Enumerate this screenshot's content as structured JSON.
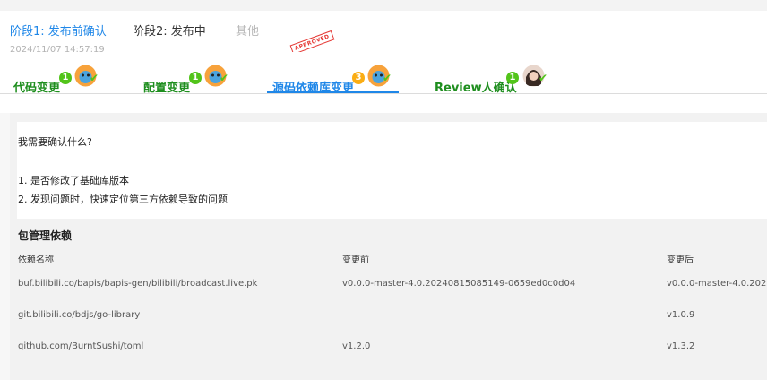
{
  "stages": [
    {
      "label": "阶段1: 发布前确认",
      "time": "2024/11/07 14:57:19"
    },
    {
      "label": "阶段2: 发布中"
    },
    {
      "label": "其他"
    }
  ],
  "stamp_text": "APPROVED",
  "tabs": [
    {
      "label": "代码变更",
      "count": "1"
    },
    {
      "label": "配置变更",
      "count": "1"
    },
    {
      "label": "源码依赖库变更",
      "count": "3"
    },
    {
      "label": "Review人确认",
      "count": "1"
    }
  ],
  "info": {
    "question": "我需要确认什么?",
    "points": [
      "1. 是否修改了基础库版本",
      "2. 发现问题时，快速定位第三方依赖导致的问题"
    ]
  },
  "dependencies": {
    "title": "包管理依赖",
    "headers": [
      "依赖名称",
      "变更前",
      "变更后"
    ],
    "rows": [
      [
        "buf.bilibili.co/bapis/bapis-gen/bilibili/broadcast.live.pk",
        "v0.0.0-master-4.0.20240815085149-0659ed0c0d04",
        "v0.0.0-master-4.0.202"
      ],
      [
        "git.bilibili.co/bdjs/go-library",
        "",
        "v1.0.9"
      ],
      [
        "github.com/BurntSushi/toml",
        "v1.2.0",
        "v1.3.2"
      ]
    ]
  }
}
